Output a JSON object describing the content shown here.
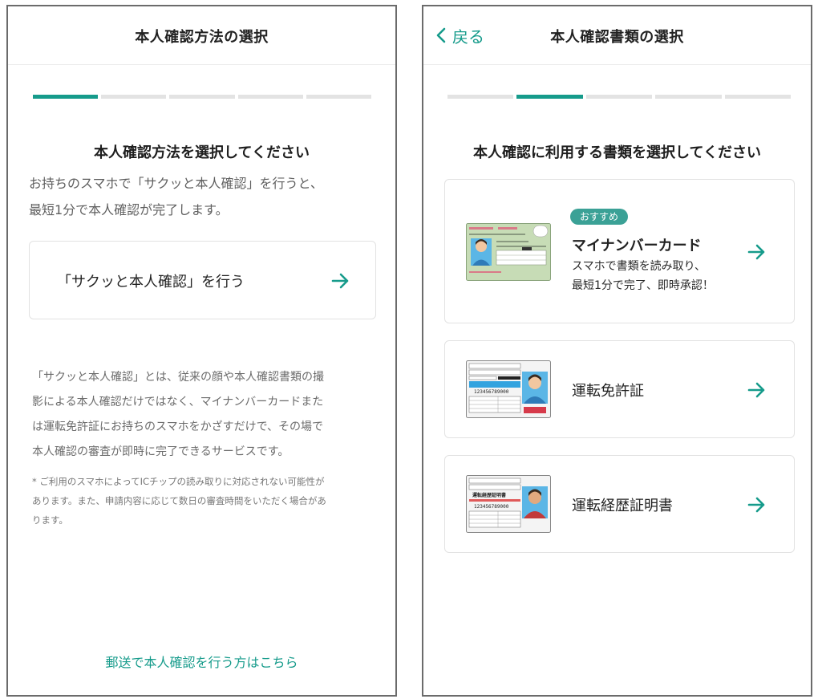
{
  "left": {
    "header_title": "本人確認方法の選択",
    "progress": {
      "total_steps": 5,
      "current_step": 1
    },
    "heading": "本人確認方法を選択してください",
    "intro_lines": [
      "お持ちのスマホで「サクッと本人確認」を行うと、",
      "最短1分で本人確認が完了します。"
    ],
    "option_label": "「サクッと本人確認」を行う",
    "description_lines": [
      "「サクッと本人確認」とは、従来の顔や本人確認書類の撮",
      "影による本人確認だけではなく、マイナンバーカードまた",
      "は運転免許証にお持ちのスマホをかざすだけで、その場で",
      "本人確認の審査が即時に完了できるサービスです。"
    ],
    "note_lines": [
      "* ご利用のスマホによってICチップの読み取りに対応されない可能性が",
      "あります。また、申請内容に応じて数日の審査時間をいただく場合があ",
      "ります。"
    ],
    "mail_link": "郵送で本人確認を行う方はこちら"
  },
  "right": {
    "back_label": "戻る",
    "header_title": "本人確認書類の選択",
    "progress": {
      "total_steps": 5,
      "current_step": 2
    },
    "heading": "本人確認に利用する書類を選択してください",
    "documents": [
      {
        "badge": "おすすめ",
        "title": "マイナンバーカード",
        "sub_lines": [
          "スマホで書類を読み取り、",
          "最短1分で完了、即時承認！"
        ]
      },
      {
        "title": "運転免許証"
      },
      {
        "title": "運転経歴証明書"
      }
    ],
    "card_texts": {
      "license_id": "123456789000",
      "history_title": "運転経歴証明書",
      "history_id": "123456789000"
    }
  },
  "colors": {
    "accent": "#169b8b",
    "badge": "#3ba196",
    "progress_inactive": "#e3e3e3",
    "card_border": "#e2e2e2",
    "license_blue": "#33a3df",
    "mynumber_green": "#c7dcb6"
  }
}
